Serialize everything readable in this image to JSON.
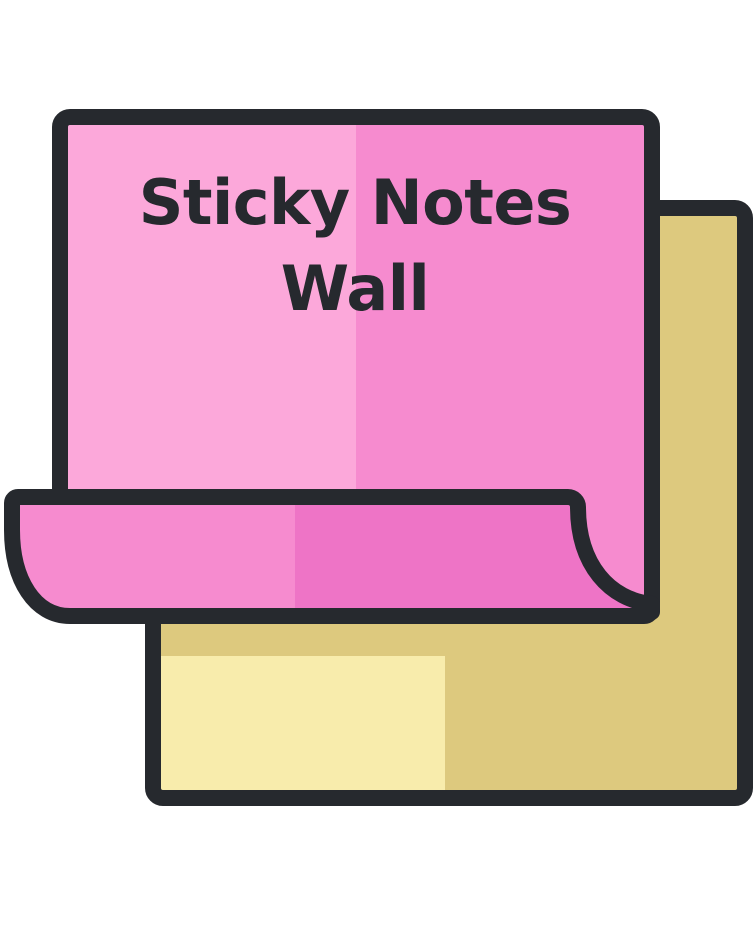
{
  "title": {
    "line1": "Sticky Notes",
    "line2": "Wall"
  },
  "colors": {
    "outline": "#26292e",
    "pink_light": "#fca8da",
    "pink_mid": "#f68bcf",
    "pink_dark": "#ee74c6",
    "yellow_light": "#f8ecac",
    "yellow_dark": "#ddc97e",
    "background": "#ffffff"
  },
  "icons": {
    "logo": "sticky-notes-icon"
  }
}
